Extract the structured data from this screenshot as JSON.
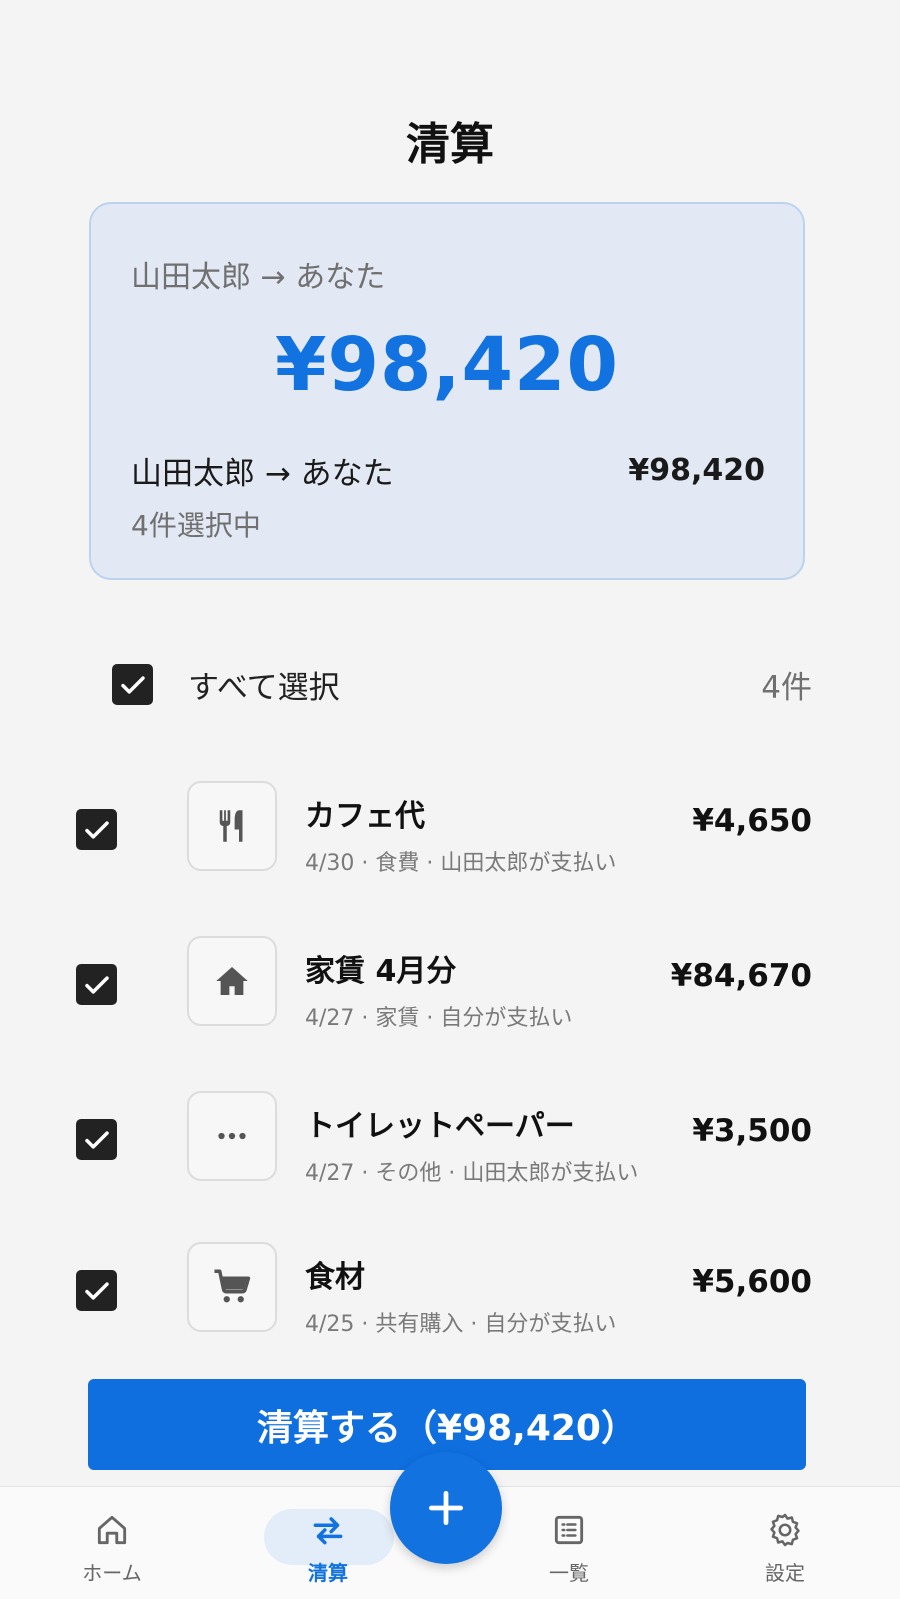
{
  "page": {
    "title": "清算"
  },
  "summary": {
    "direction": "山田太郎 → あなた",
    "amount": "¥98,420",
    "row_direction": "山田太郎 → あなた",
    "row_amount": "¥98,420",
    "selected_count": "4件選択中"
  },
  "select_all": {
    "label": "すべて選択",
    "count": "4件",
    "checked": true
  },
  "items": [
    {
      "title": "カフェ代",
      "meta": "4/30 · 食費 · 山田太郎が支払い",
      "amount": "¥4,650",
      "icon": "fork-knife-icon",
      "checked": true
    },
    {
      "title": "家賃 4月分",
      "meta": "4/27 · 家賃 · 自分が支払い",
      "amount": "¥84,670",
      "icon": "home-icon",
      "checked": true
    },
    {
      "title": "トイレットペーパー",
      "meta": "4/27 · その他 · 山田太郎が支払い",
      "amount": "¥3,500",
      "icon": "more-dots-icon",
      "checked": true
    },
    {
      "title": "食材",
      "meta": "4/25 · 共有購入 · 自分が支払い",
      "amount": "¥5,600",
      "icon": "cart-icon",
      "checked": true
    }
  ],
  "settle_button": {
    "label": "清算する（¥98,420）"
  },
  "nav": {
    "home": "ホーム",
    "settle": "清算",
    "list": "一覧",
    "settings": "設定",
    "active": "settle"
  },
  "colors": {
    "accent": "#1172e0",
    "card_bg": "#e2e9f4",
    "card_border": "#bcd3ef"
  }
}
